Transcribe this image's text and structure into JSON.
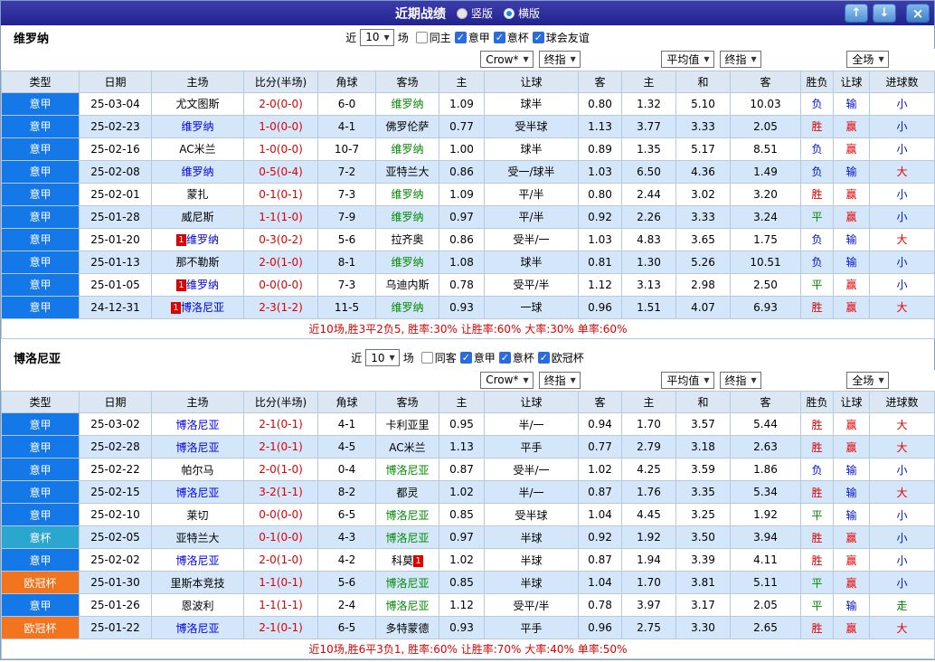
{
  "titlebar": {
    "title": "近期战绩",
    "vertical_label": "竖版",
    "horizontal_label": "横版",
    "selected_mode": "横版",
    "up_icon": "↑",
    "down_icon": "↓",
    "close_icon": "×"
  },
  "columns": [
    "类型",
    "日期",
    "主场",
    "比分(半场)",
    "角球",
    "客场",
    "主",
    "让球",
    "客",
    "主",
    "和",
    "客",
    "胜负",
    "让球",
    "进球数"
  ],
  "sections": [
    {
      "id": "verona",
      "team": "维罗纳",
      "filter": {
        "near_label": "近",
        "count": "10",
        "games_label": "场",
        "checkboxes": [
          {
            "label": "同主",
            "checked": false
          },
          {
            "label": "意甲",
            "checked": true
          },
          {
            "label": "意杯",
            "checked": true
          },
          {
            "label": "球会友谊",
            "checked": true
          }
        ]
      },
      "dropdowns": {
        "asia_company": "Crow*",
        "asia_time": "终指",
        "euro_company": "平均值",
        "euro_time": "终指",
        "scope": "全场"
      },
      "rows": [
        {
          "league": "意甲",
          "league_class": "lg-serie",
          "date": "25-03-04",
          "home": "尤文图斯",
          "home_class": "tm-plain",
          "home_badge": "",
          "score": "2-0(0-0)",
          "corner": "6-0",
          "away": "维罗纳",
          "away_class": "tm-away",
          "away_badge": "",
          "asia": [
            "1.09",
            "球半",
            "0.80"
          ],
          "euro": [
            "1.32",
            "5.10",
            "10.03"
          ],
          "result": {
            "t": "负",
            "c": "v-lose"
          },
          "cover": {
            "t": "输",
            "c": "v-lose"
          },
          "goals": {
            "t": "小",
            "c": "v-lose"
          }
        },
        {
          "league": "意甲",
          "league_class": "lg-serie",
          "date": "25-02-23",
          "home": "维罗纳",
          "home_class": "tm-home",
          "home_badge": "",
          "score": "1-0(0-0)",
          "corner": "4-1",
          "away": "佛罗伦萨",
          "away_class": "tm-plain",
          "away_badge": "",
          "asia": [
            "0.77",
            "受半球",
            "1.13"
          ],
          "euro": [
            "3.77",
            "3.33",
            "2.05"
          ],
          "result": {
            "t": "胜",
            "c": "v-win"
          },
          "cover": {
            "t": "赢",
            "c": "v-win"
          },
          "goals": {
            "t": "小",
            "c": "v-lose"
          }
        },
        {
          "league": "意甲",
          "league_class": "lg-serie",
          "date": "25-02-16",
          "home": "AC米兰",
          "home_class": "tm-plain",
          "home_badge": "",
          "score": "1-0(0-0)",
          "corner": "10-7",
          "away": "维罗纳",
          "away_class": "tm-away",
          "away_badge": "",
          "asia": [
            "1.00",
            "球半",
            "0.89"
          ],
          "euro": [
            "1.35",
            "5.17",
            "8.51"
          ],
          "result": {
            "t": "负",
            "c": "v-lose"
          },
          "cover": {
            "t": "赢",
            "c": "v-win"
          },
          "goals": {
            "t": "小",
            "c": "v-lose"
          }
        },
        {
          "league": "意甲",
          "league_class": "lg-serie",
          "date": "25-02-08",
          "home": "维罗纳",
          "home_class": "tm-home",
          "home_badge": "",
          "score": "0-5(0-4)",
          "corner": "7-2",
          "away": "亚特兰大",
          "away_class": "tm-plain",
          "away_badge": "",
          "asia": [
            "0.86",
            "受一/球半",
            "1.03"
          ],
          "euro": [
            "6.50",
            "4.36",
            "1.49"
          ],
          "result": {
            "t": "负",
            "c": "v-lose"
          },
          "cover": {
            "t": "输",
            "c": "v-lose"
          },
          "goals": {
            "t": "大",
            "c": "v-win"
          }
        },
        {
          "league": "意甲",
          "league_class": "lg-serie",
          "date": "25-02-01",
          "home": "蒙扎",
          "home_class": "tm-plain",
          "home_badge": "",
          "score": "0-1(0-1)",
          "corner": "7-3",
          "away": "维罗纳",
          "away_class": "tm-away",
          "away_badge": "",
          "asia": [
            "1.09",
            "平/半",
            "0.80"
          ],
          "euro": [
            "2.44",
            "3.02",
            "3.20"
          ],
          "result": {
            "t": "胜",
            "c": "v-win"
          },
          "cover": {
            "t": "赢",
            "c": "v-win"
          },
          "goals": {
            "t": "小",
            "c": "v-lose"
          }
        },
        {
          "league": "意甲",
          "league_class": "lg-serie",
          "date": "25-01-28",
          "home": "威尼斯",
          "home_class": "tm-plain",
          "home_badge": "",
          "score": "1-1(1-0)",
          "corner": "7-9",
          "away": "维罗纳",
          "away_class": "tm-away",
          "away_badge": "",
          "asia": [
            "0.97",
            "平/半",
            "0.92"
          ],
          "euro": [
            "2.26",
            "3.33",
            "3.24"
          ],
          "result": {
            "t": "平",
            "c": "v-draw"
          },
          "cover": {
            "t": "赢",
            "c": "v-win"
          },
          "goals": {
            "t": "小",
            "c": "v-lose"
          }
        },
        {
          "league": "意甲",
          "league_class": "lg-serie",
          "date": "25-01-20",
          "home": "维罗纳",
          "home_class": "tm-home",
          "home_badge": "1",
          "score": "0-3(0-2)",
          "corner": "5-6",
          "away": "拉齐奥",
          "away_class": "tm-plain",
          "away_badge": "",
          "asia": [
            "0.86",
            "受半/一",
            "1.03"
          ],
          "euro": [
            "4.83",
            "3.65",
            "1.75"
          ],
          "result": {
            "t": "负",
            "c": "v-lose"
          },
          "cover": {
            "t": "输",
            "c": "v-lose"
          },
          "goals": {
            "t": "大",
            "c": "v-win"
          }
        },
        {
          "league": "意甲",
          "league_class": "lg-serie",
          "date": "25-01-13",
          "home": "那不勒斯",
          "home_class": "tm-plain",
          "home_badge": "",
          "score": "2-0(1-0)",
          "corner": "8-1",
          "away": "维罗纳",
          "away_class": "tm-away",
          "away_badge": "",
          "asia": [
            "1.08",
            "球半",
            "0.81"
          ],
          "euro": [
            "1.30",
            "5.26",
            "10.51"
          ],
          "result": {
            "t": "负",
            "c": "v-lose"
          },
          "cover": {
            "t": "输",
            "c": "v-lose"
          },
          "goals": {
            "t": "小",
            "c": "v-lose"
          }
        },
        {
          "league": "意甲",
          "league_class": "lg-serie",
          "date": "25-01-05",
          "home": "维罗纳",
          "home_class": "tm-home",
          "home_badge": "1",
          "score": "0-0(0-0)",
          "corner": "7-3",
          "away": "乌迪内斯",
          "away_class": "tm-plain",
          "away_badge": "",
          "asia": [
            "0.78",
            "受平/半",
            "1.12"
          ],
          "euro": [
            "3.13",
            "2.98",
            "2.50"
          ],
          "result": {
            "t": "平",
            "c": "v-draw"
          },
          "cover": {
            "t": "赢",
            "c": "v-win"
          },
          "goals": {
            "t": "小",
            "c": "v-lose"
          }
        },
        {
          "league": "意甲",
          "league_class": "lg-serie",
          "date": "24-12-31",
          "home": "博洛尼亚",
          "home_class": "tm-home",
          "home_badge": "1",
          "score": "2-3(1-2)",
          "corner": "11-5",
          "away": "维罗纳",
          "away_class": "tm-away",
          "away_badge": "",
          "asia": [
            "0.93",
            "一球",
            "0.96"
          ],
          "euro": [
            "1.51",
            "4.07",
            "6.93"
          ],
          "result": {
            "t": "胜",
            "c": "v-win"
          },
          "cover": {
            "t": "赢",
            "c": "v-win"
          },
          "goals": {
            "t": "大",
            "c": "v-win"
          }
        }
      ],
      "footer": "近10场,胜3平2负5, 胜率:30% 让胜率:60% 大率:30% 单率:60%"
    },
    {
      "id": "bologna",
      "team": "博洛尼亚",
      "filter": {
        "near_label": "近",
        "count": "10",
        "games_label": "场",
        "checkboxes": [
          {
            "label": "同客",
            "checked": false
          },
          {
            "label": "意甲",
            "checked": true
          },
          {
            "label": "意杯",
            "checked": true
          },
          {
            "label": "欧冠杯",
            "checked": true
          }
        ]
      },
      "dropdowns": {
        "asia_company": "Crow*",
        "asia_time": "终指",
        "euro_company": "平均值",
        "euro_time": "终指",
        "scope": "全场"
      },
      "rows": [
        {
          "league": "意甲",
          "league_class": "lg-serie",
          "date": "25-03-02",
          "home": "博洛尼亚",
          "home_class": "tm-home",
          "home_badge": "",
          "score": "2-1(0-1)",
          "corner": "4-1",
          "away": "卡利亚里",
          "away_class": "tm-plain",
          "away_badge": "",
          "asia": [
            "0.95",
            "半/一",
            "0.94"
          ],
          "euro": [
            "1.70",
            "3.57",
            "5.44"
          ],
          "result": {
            "t": "胜",
            "c": "v-win"
          },
          "cover": {
            "t": "赢",
            "c": "v-win"
          },
          "goals": {
            "t": "大",
            "c": "v-win"
          }
        },
        {
          "league": "意甲",
          "league_class": "lg-serie",
          "date": "25-02-28",
          "home": "博洛尼亚",
          "home_class": "tm-home",
          "home_badge": "",
          "score": "2-1(0-1)",
          "corner": "4-5",
          "away": "AC米兰",
          "away_class": "tm-plain",
          "away_badge": "",
          "asia": [
            "1.13",
            "平手",
            "0.77"
          ],
          "euro": [
            "2.79",
            "3.18",
            "2.63"
          ],
          "result": {
            "t": "胜",
            "c": "v-win"
          },
          "cover": {
            "t": "赢",
            "c": "v-win"
          },
          "goals": {
            "t": "大",
            "c": "v-win"
          }
        },
        {
          "league": "意甲",
          "league_class": "lg-serie",
          "date": "25-02-22",
          "home": "帕尔马",
          "home_class": "tm-plain",
          "home_badge": "",
          "score": "2-0(1-0)",
          "corner": "0-4",
          "away": "博洛尼亚",
          "away_class": "tm-away",
          "away_badge": "",
          "asia": [
            "0.87",
            "受半/一",
            "1.02"
          ],
          "euro": [
            "4.25",
            "3.59",
            "1.86"
          ],
          "result": {
            "t": "负",
            "c": "v-lose"
          },
          "cover": {
            "t": "输",
            "c": "v-lose"
          },
          "goals": {
            "t": "小",
            "c": "v-lose"
          }
        },
        {
          "league": "意甲",
          "league_class": "lg-serie",
          "date": "25-02-15",
          "home": "博洛尼亚",
          "home_class": "tm-home",
          "home_badge": "",
          "score": "3-2(1-1)",
          "corner": "8-2",
          "away": "都灵",
          "away_class": "tm-plain",
          "away_badge": "",
          "asia": [
            "1.02",
            "半/一",
            "0.87"
          ],
          "euro": [
            "1.76",
            "3.35",
            "5.34"
          ],
          "result": {
            "t": "胜",
            "c": "v-win"
          },
          "cover": {
            "t": "输",
            "c": "v-lose"
          },
          "goals": {
            "t": "大",
            "c": "v-win"
          }
        },
        {
          "league": "意甲",
          "league_class": "lg-serie",
          "date": "25-02-10",
          "home": "莱切",
          "home_class": "tm-plain",
          "home_badge": "",
          "score": "0-0(0-0)",
          "corner": "6-5",
          "away": "博洛尼亚",
          "away_class": "tm-away",
          "away_badge": "",
          "asia": [
            "0.85",
            "受半球",
            "1.04"
          ],
          "euro": [
            "4.45",
            "3.25",
            "1.92"
          ],
          "result": {
            "t": "平",
            "c": "v-draw"
          },
          "cover": {
            "t": "输",
            "c": "v-lose"
          },
          "goals": {
            "t": "小",
            "c": "v-lose"
          }
        },
        {
          "league": "意杯",
          "league_class": "lg-coppa",
          "date": "25-02-05",
          "home": "亚特兰大",
          "home_class": "tm-plain",
          "home_badge": "",
          "score": "0-1(0-0)",
          "corner": "4-3",
          "away": "博洛尼亚",
          "away_class": "tm-away",
          "away_badge": "",
          "asia": [
            "0.97",
            "半球",
            "0.92"
          ],
          "euro": [
            "1.92",
            "3.50",
            "3.94"
          ],
          "result": {
            "t": "胜",
            "c": "v-win"
          },
          "cover": {
            "t": "赢",
            "c": "v-win"
          },
          "goals": {
            "t": "小",
            "c": "v-lose"
          }
        },
        {
          "league": "意甲",
          "league_class": "lg-serie",
          "date": "25-02-02",
          "home": "博洛尼亚",
          "home_class": "tm-home",
          "home_badge": "",
          "score": "2-0(1-0)",
          "corner": "4-2",
          "away": "科莫",
          "away_class": "tm-plain",
          "away_badge": "1",
          "asia": [
            "1.02",
            "半球",
            "0.87"
          ],
          "euro": [
            "1.94",
            "3.39",
            "4.11"
          ],
          "result": {
            "t": "胜",
            "c": "v-win"
          },
          "cover": {
            "t": "赢",
            "c": "v-win"
          },
          "goals": {
            "t": "小",
            "c": "v-lose"
          }
        },
        {
          "league": "欧冠杯",
          "league_class": "lg-ucl",
          "date": "25-01-30",
          "home": "里斯本竞技",
          "home_class": "tm-plain",
          "home_badge": "",
          "score": "1-1(0-1)",
          "corner": "5-6",
          "away": "博洛尼亚",
          "away_class": "tm-away",
          "away_badge": "",
          "asia": [
            "0.85",
            "半球",
            "1.04"
          ],
          "euro": [
            "1.70",
            "3.81",
            "5.11"
          ],
          "result": {
            "t": "平",
            "c": "v-draw"
          },
          "cover": {
            "t": "赢",
            "c": "v-win"
          },
          "goals": {
            "t": "小",
            "c": "v-lose"
          }
        },
        {
          "league": "意甲",
          "league_class": "lg-serie",
          "date": "25-01-26",
          "home": "恩波利",
          "home_class": "tm-plain",
          "home_badge": "",
          "score": "1-1(1-1)",
          "corner": "2-4",
          "away": "博洛尼亚",
          "away_class": "tm-away",
          "away_badge": "",
          "asia": [
            "1.12",
            "受平/半",
            "0.78"
          ],
          "euro": [
            "3.97",
            "3.17",
            "2.05"
          ],
          "result": {
            "t": "平",
            "c": "v-draw"
          },
          "cover": {
            "t": "输",
            "c": "v-lose"
          },
          "goals": {
            "t": "走",
            "c": "v-draw"
          }
        },
        {
          "league": "欧冠杯",
          "league_class": "lg-ucl",
          "date": "25-01-22",
          "home": "博洛尼亚",
          "home_class": "tm-home",
          "home_badge": "",
          "score": "2-1(0-1)",
          "corner": "6-5",
          "away": "多特蒙德",
          "away_class": "tm-plain",
          "away_badge": "",
          "asia": [
            "0.93",
            "平手",
            "0.96"
          ],
          "euro": [
            "2.75",
            "3.30",
            "2.65"
          ],
          "result": {
            "t": "胜",
            "c": "v-win"
          },
          "cover": {
            "t": "赢",
            "c": "v-win"
          },
          "goals": {
            "t": "大",
            "c": "v-win"
          }
        }
      ],
      "footer": "近10场,胜6平3负1, 胜率:60% 让胜率:70% 大率:40% 单率:50%"
    }
  ],
  "colors": {
    "serie_a": "#1478e8",
    "coppa_italia": "#2ba6cf",
    "champions_league": "#f2741e",
    "win": "#e60000",
    "draw": "#008a00",
    "lose": "#0013cc",
    "titlebar": "#2b2b9b"
  }
}
